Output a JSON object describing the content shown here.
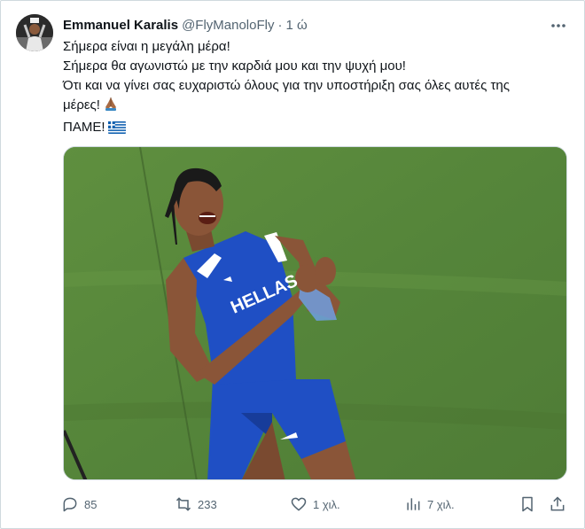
{
  "author": {
    "display_name": "Emmanuel Karalis",
    "handle": "@FlyManoloFly",
    "separator": "·",
    "time": "1 ώ"
  },
  "tweet": {
    "lines": [
      "Σήμερα είναι η μεγάλη μέρα!",
      "Σήμερα θα αγωνιστώ με την καρδιά μου και την ψυχή μου!",
      "Ότι και να γίνει σας ευχαριστώ όλους για την υποστήριξη σας όλες αυτές της",
      "μέρες!",
      "ΠΑΜΕ!"
    ],
    "emojis": [
      "folded-hands-emoji",
      "greece-flag-emoji"
    ]
  },
  "media": {
    "jersey_text": "HELLAS"
  },
  "actions": {
    "reply_count": "85",
    "retweet_count": "233",
    "like_count": "1 χιλ.",
    "views_count": "7 χιλ."
  },
  "colors": {
    "text_primary": "#0f1419",
    "text_secondary": "#536471",
    "border": "#cfd9de",
    "jersey_blue": "#1f4fc4",
    "field_green": "#5b8a3c"
  }
}
